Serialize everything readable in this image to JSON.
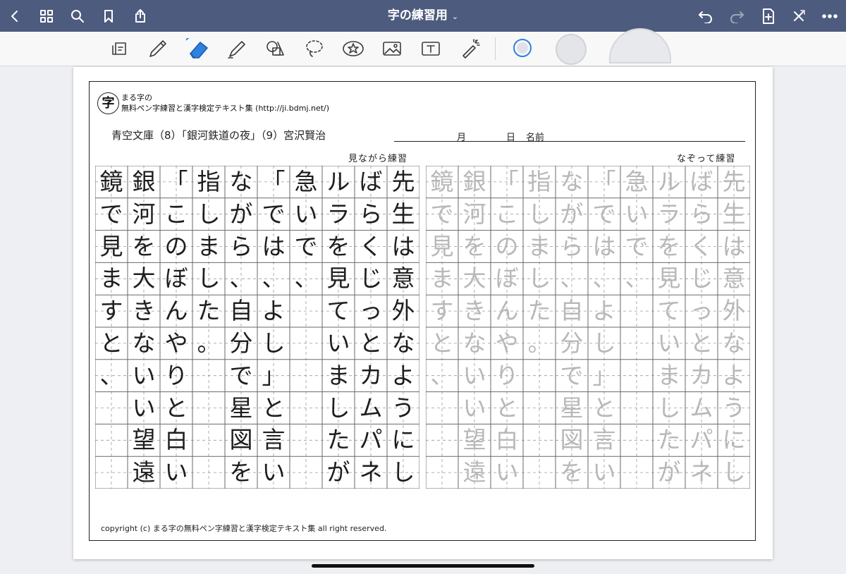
{
  "app": {
    "title": "字の練習用",
    "title_chevron": "⌄"
  },
  "toolbar": {
    "tools": [
      "page-mode",
      "pen",
      "eraser",
      "highlighter",
      "shapes",
      "lasso",
      "stickers",
      "image",
      "text",
      "laser-pointer"
    ],
    "active_tool": "eraser",
    "size_options": [
      "small",
      "medium",
      "large"
    ],
    "selected_size": "small"
  },
  "sheet": {
    "logo_char": "字",
    "site_name": "まる字の",
    "site_desc": "無料ペン字練習と漢字検定テキスト集 (http://ji.bdmj.net/)",
    "title": "青空文庫（8）「銀河鉄道の夜」（9）宮沢賢治",
    "month_label": "月",
    "day_label": "日",
    "name_label": "名前",
    "left_label": "見ながら練習",
    "right_label": "なぞって練習",
    "footer": "copyright (c) まる字の無料ペン字練習と漢字検定テキスト集 all right reserved."
  },
  "columns": [
    [
      "鏡",
      "で",
      "見",
      "ま",
      "す",
      "と",
      "、",
      "",
      "",
      ""
    ],
    [
      "銀",
      "河",
      "を",
      "大",
      "き",
      "な",
      "い",
      "い",
      "望",
      "遠"
    ],
    [
      "「",
      "こ",
      "の",
      "ぼ",
      "ん",
      "や",
      "り",
      "と",
      "白",
      "い"
    ],
    [
      "指",
      "し",
      "ま",
      "し",
      "た",
      "。",
      "",
      "",
      "",
      ""
    ],
    [
      "な",
      "が",
      "ら",
      "、",
      "自",
      "分",
      "で",
      "星",
      "図",
      "を"
    ],
    [
      "「",
      "で",
      "は",
      "、",
      "よ",
      "し",
      "」",
      "と",
      "言",
      "い"
    ],
    [
      "急",
      "い",
      "で",
      "、",
      "",
      "",
      "",
      "",
      "",
      ""
    ],
    [
      "ル",
      "ラ",
      "を",
      "見",
      "て",
      "い",
      "ま",
      "し",
      "た",
      "が"
    ],
    [
      "ば",
      "ら",
      "く",
      "じ",
      "っ",
      "と",
      "カ",
      "ム",
      "パ",
      "ネ"
    ],
    [
      "先",
      "生",
      "は",
      "意",
      "外",
      "な",
      "よ",
      "う",
      "に",
      "し"
    ]
  ],
  "colors": {
    "topbar": "#4d5b7e",
    "grid": "#6a6a6a",
    "trace_text": "#b8b8b8"
  }
}
